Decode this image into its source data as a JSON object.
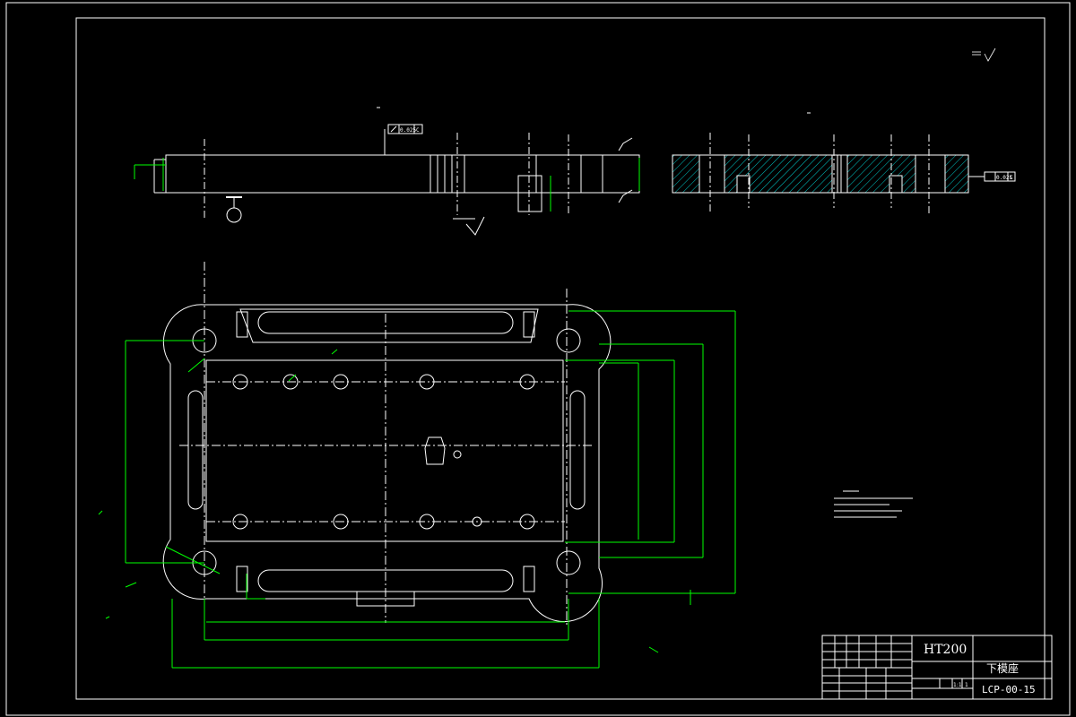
{
  "drawing": {
    "colors": {
      "background": "#000000",
      "outline": "#ffffff",
      "dimension": "#00ff00",
      "hatch": "#00c8c8"
    },
    "tolerance_left": "0.025",
    "datum_left": "C",
    "tolerance_right": "0.025",
    "datum_right": "C",
    "title_block": {
      "material": "HT200",
      "part_name": "下模座",
      "drawing_number": "LCP-00-15",
      "scale": "1:1",
      "quantity": "1"
    }
  }
}
